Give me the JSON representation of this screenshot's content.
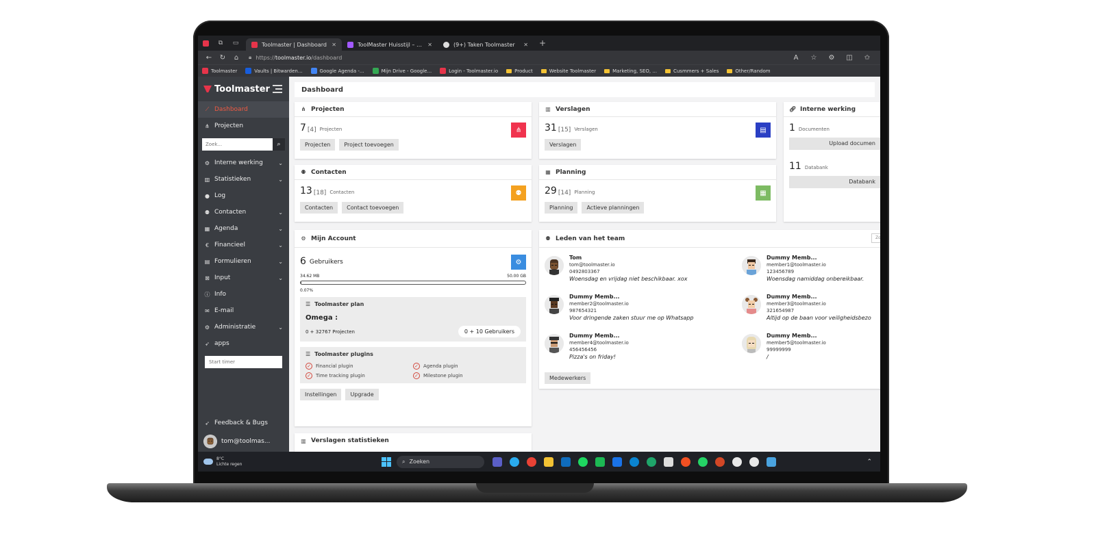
{
  "browser": {
    "tabs": [
      {
        "title": "Toolmaster | Dashboard",
        "active": true
      },
      {
        "title": "ToolMaster Huisstijl – Figma",
        "active": false
      },
      {
        "title": "(9+) Taken Toolmaster",
        "active": false
      }
    ],
    "url_prefix": "https://",
    "url_host": "toolmaster.io",
    "url_path": "/dashboard",
    "bookmarks": [
      "Toolmaster",
      "Vaults | Bitwarden...",
      "Google Agenda -...",
      "Mijn Drive - Google...",
      "Login - Toolmaster.io",
      "Product",
      "Website Toolmaster",
      "Marketing, SEO, ...",
      "Cusmmers + Sales",
      "Other/Random"
    ]
  },
  "sidebar": {
    "brand": "Toolmaster",
    "search_placeholder": "Zoek...",
    "timer_placeholder": "Start timer",
    "items": [
      {
        "label": "Dashboard",
        "icon": "chart-line-icon"
      },
      {
        "label": "Projecten",
        "icon": "sitemap-icon"
      },
      {
        "label": "Interne werking",
        "icon": "cogs-icon"
      },
      {
        "label": "Statistieken",
        "icon": "bar-chart-icon"
      },
      {
        "label": "Log",
        "icon": "comments-icon"
      },
      {
        "label": "Contacten",
        "icon": "users-icon"
      },
      {
        "label": "Agenda",
        "icon": "calendar-icon"
      },
      {
        "label": "Financieel",
        "icon": "euro-icon"
      },
      {
        "label": "Formulieren",
        "icon": "file-icon"
      },
      {
        "label": "Input",
        "icon": "inbox-icon"
      },
      {
        "label": "Info",
        "icon": "info-icon"
      },
      {
        "label": "E-mail",
        "icon": "envelope-icon"
      },
      {
        "label": "Administratie",
        "icon": "user-cog-icon"
      },
      {
        "label": "apps",
        "icon": "rocket-icon"
      }
    ],
    "feedback": "Feedback & Bugs",
    "user": "tom@toolmas..."
  },
  "page_title": "Dashboard",
  "cards": {
    "projecten": {
      "title": "Projecten",
      "count": "7",
      "sub": "[4]",
      "label": "Projecten",
      "btn1": "Projecten",
      "btn2": "Project toevoegen",
      "color": "#f0334e"
    },
    "verslagen": {
      "title": "Verslagen",
      "count": "31",
      "sub": "[15]",
      "label": "Verslagen",
      "btn1": "Verslagen",
      "color": "#2a3fc4"
    },
    "intern": {
      "title": "Interne werking",
      "docs_count": "1",
      "docs_label": "Documenten",
      "upload": "Upload documen",
      "db_count": "11",
      "db_label": "Databank",
      "db_btn": "Databank"
    },
    "contacten": {
      "title": "Contacten",
      "count": "13",
      "sub": "[18]",
      "label": "Contacten",
      "btn1": "Contacten",
      "btn2": "Contact toevoegen",
      "color": "#f4a120"
    },
    "planning": {
      "title": "Planning",
      "count": "29",
      "sub": "[14]",
      "label": "Planning",
      "btn1": "Planning",
      "btn2": "Actieve planningen",
      "color": "#7dbb63"
    },
    "account": {
      "title": "Mijn Account",
      "count": "6",
      "label": "Gebruikers",
      "color": "#3a8de0",
      "used": "34.62 MB",
      "total": "50.00 GB",
      "percent": "0.07%",
      "progress_fraction": 0.0007,
      "plan_title": "Toolmaster plan",
      "plan_name": "Omega :",
      "plan_projects": "0 + 32767 Projecten",
      "plan_users": "0 + 10 Gebruikers",
      "plugins_title": "Toolmaster plugins",
      "plugins": [
        "Financial plugin",
        "Agenda plugin",
        "Time tracking plugin",
        "Milestone plugin"
      ],
      "btn1": "Instellingen",
      "btn2": "Upgrade"
    },
    "team": {
      "title": "Leden van het team",
      "search": "Zoek",
      "members": [
        {
          "name": "Tom",
          "email": "tom@toolmaster.io",
          "phone": "0492803367",
          "note": "Woensdag en vrijdag niet beschikbaar. xox"
        },
        {
          "name": "Dummy Memb...",
          "email": "member1@toolmaster.io",
          "phone": "123456789",
          "note": "Woensdag namiddag onbereikbaar."
        },
        {
          "name": "Dummy Memb...",
          "email": "member2@toolmaster.io",
          "phone": "987654321",
          "note": "Voor dringende zaken stuur me op Whatsapp"
        },
        {
          "name": "Dummy Memb...",
          "email": "member3@toolmaster.io",
          "phone": "321654987",
          "note": "Altijd op de baan voor veiligheidsbezo"
        },
        {
          "name": "Dummy Memb...",
          "email": "member4@toolmaster.io",
          "phone": "456456456",
          "note": "Pizza's on friday!"
        },
        {
          "name": "Dummy Memb...",
          "email": "member5@toolmaster.io",
          "phone": "99999999",
          "note": "/"
        }
      ],
      "btn": "Medewerkers"
    },
    "verslagen_stats": {
      "title": "Verslagen statistieken"
    }
  },
  "taskbar": {
    "temp": "8°C",
    "weather": "Lichte regen",
    "search": "Zoeken"
  }
}
